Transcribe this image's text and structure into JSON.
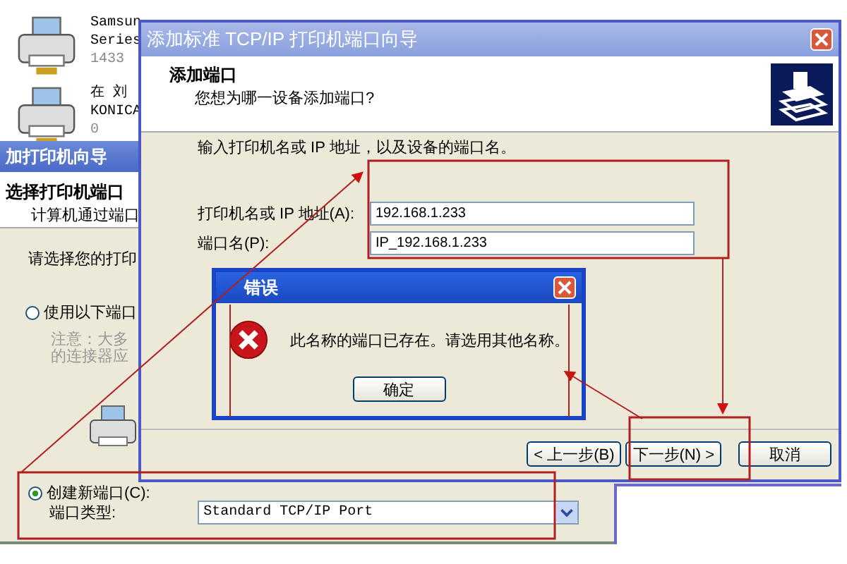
{
  "printer_list": {
    "items": [
      {
        "lines": [
          "Samsun",
          "Series",
          "1433"
        ]
      },
      {
        "lines": [
          "在 刘",
          "KONICA",
          "0"
        ]
      }
    ]
  },
  "back_window": {
    "title": "加打印机向导",
    "header_title": "选择打印机端口",
    "header_subtitle": "计算机通过端口",
    "prompt": "请选择您的打印",
    "options": [
      {
        "label": "使用以下端口",
        "selected": false
      },
      {
        "label": "创建新端口(C):",
        "selected": true
      }
    ],
    "note_lines": [
      "注意：大多",
      "的连接器应"
    ],
    "port_type_label": "端口类型:",
    "port_type_value": "Standard TCP/IP Port"
  },
  "front_window": {
    "title": "添加标准 TCP/IP 打印机端口向导",
    "header_title": "添加端口",
    "header_subtitle": "您想为哪一设备添加端口?",
    "instruction": "输入打印机名或 IP 地址，以及设备的端口名。",
    "fields": [
      {
        "label": "打印机名或 IP 地址(A):",
        "value": "192.168.1.233"
      },
      {
        "label": "端口名(P):",
        "value": "IP_192.168.1.233"
      }
    ],
    "buttons": [
      "< 上一步(B)",
      "下一步(N) >",
      "取消"
    ]
  },
  "error_dialog": {
    "title": "错误",
    "message": "此名称的端口已存在。请选用其他名称。",
    "button": "确定"
  }
}
